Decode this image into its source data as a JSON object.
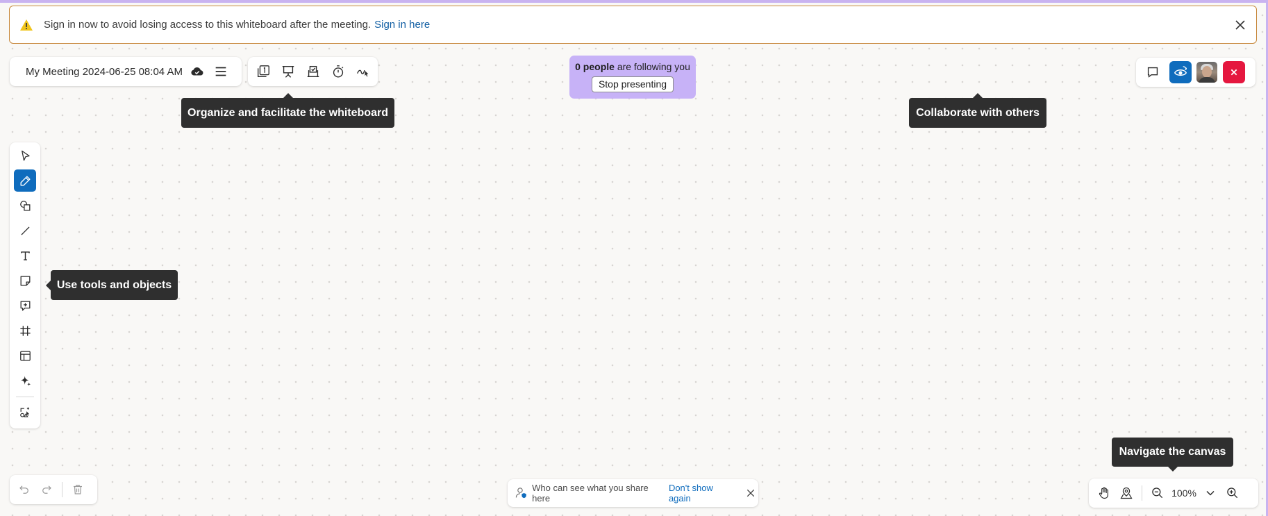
{
  "banner": {
    "message": "Sign in now to avoid losing access to this whiteboard after the meeting.",
    "link": "Sign in here"
  },
  "header": {
    "title": "My Meeting 2024-06-25 08:04 AM"
  },
  "presenting": {
    "count": "0 people",
    "suffix": "are following you",
    "stop_label": "Stop presenting"
  },
  "tooltips": {
    "organize": "Organize and facilitate the whiteboard",
    "collaborate": "Collaborate with others",
    "tools": "Use tools and objects",
    "navigate": "Navigate the canvas"
  },
  "share_hint": {
    "text": "Who can see what you share here",
    "dismiss": "Don't show again"
  },
  "zoom": {
    "level": "100%"
  },
  "colors": {
    "accent": "#0f6cbd",
    "presenting_bg": "#c7b2f7",
    "leave": "#e5173f",
    "banner_border": "#c7873a"
  },
  "icons": {
    "toolbar": [
      "select-icon",
      "pen-icon",
      "shapes-icon",
      "line-icon",
      "text-icon",
      "sticky-note-icon",
      "comment-icon",
      "frame-icon",
      "template-icon",
      "ai-sparkle-icon",
      "insert-media-icon"
    ]
  }
}
